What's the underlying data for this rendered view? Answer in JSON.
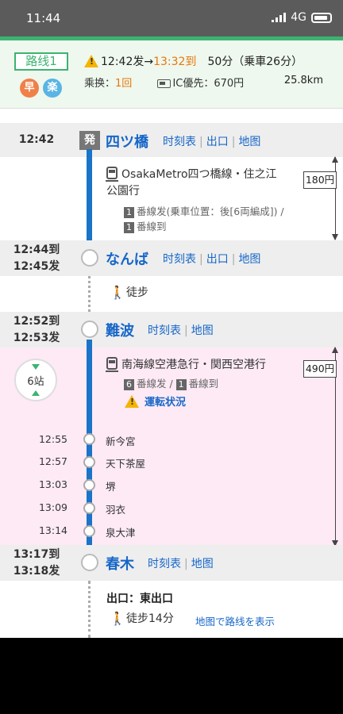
{
  "status_bar": {
    "time": "11:44",
    "network": "4G"
  },
  "summary": {
    "route_label": "路线1",
    "badge_fast": "早",
    "badge_easy": "楽",
    "depart": "12:42发→",
    "arrive": "13:32到",
    "duration": "50分（乗車26分）",
    "transfers_label": "乘换：",
    "transfers": "1回",
    "ic_fare": "IC優先：670円",
    "distance": "25.8km"
  },
  "links": {
    "timetable": "时刻表",
    "exit": "出口",
    "map": "地图"
  },
  "stations": [
    {
      "time": "12:42",
      "mark": "発",
      "name": "四ツ橋"
    },
    {
      "time_arr": "12:44到",
      "time_dep": "12:45发",
      "name": "なんば"
    },
    {
      "time_arr": "12:52到",
      "time_dep": "12:53发",
      "name": "難波"
    },
    {
      "time_arr": "13:17到",
      "time_dep": "13:18发",
      "name": "春木"
    }
  ],
  "segment1": {
    "line": "OsakaMetro四つ橋線・住之江",
    "line_cont": "公園行",
    "plat_dep_num": "1",
    "plat_dep": "番線发(乗車位置：後[6両編成]) /",
    "plat_arr_num": "1",
    "plat_arr": "番線到",
    "fare": "180円"
  },
  "walk1": {
    "label": "徒步"
  },
  "segment2": {
    "line": "南海線空港急行・関西空港行",
    "plat_dep_num": "6",
    "plat_dep": "番線发 /",
    "plat_arr_num": "1",
    "plat_arr": "番線到",
    "status": "運転状況",
    "fare": "490円",
    "stops_count": "6站",
    "stops": [
      {
        "time": "12:55",
        "name": "新今宮"
      },
      {
        "time": "12:57",
        "name": "天下茶屋"
      },
      {
        "time": "13:03",
        "name": "堺"
      },
      {
        "time": "13:09",
        "name": "羽衣"
      },
      {
        "time": "13:14",
        "name": "泉大津"
      }
    ]
  },
  "exit_info": {
    "exit": "出口：東出口",
    "walk": "徒步14分",
    "map_link": "地图で路线を表示"
  }
}
